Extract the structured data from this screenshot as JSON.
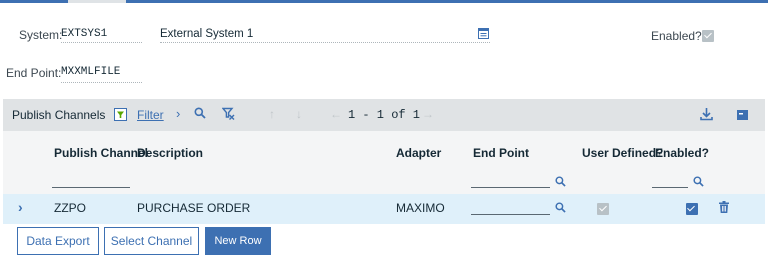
{
  "header": {
    "system_label": "System:",
    "system_value": "EXTSYS1",
    "system_description": "External System 1",
    "enabled_label": "Enabled?",
    "enabled_checked": true,
    "endpoint_label": "End Point:",
    "endpoint_value": "MXXMLFILE"
  },
  "table": {
    "title": "Publish Channels",
    "filter_label": "Filter",
    "pagination": "1 - 1 of 1",
    "columns": {
      "publish_channel": "Publish Channel",
      "description": "Description",
      "adapter": "Adapter",
      "end_point": "End Point",
      "user_defined": "User Defined?",
      "enabled": "Enabled?"
    },
    "rows": [
      {
        "publish_channel": "ZZPO",
        "description": "PURCHASE ORDER",
        "adapter": "MAXIMO",
        "end_point": "",
        "user_defined": true,
        "enabled": true
      }
    ]
  },
  "buttons": {
    "data_export": "Data Export",
    "select_channel": "Select Channel",
    "new_row": "New Row"
  },
  "colors": {
    "accent": "#3d70b2",
    "toolbar_bg": "#e0e3e5",
    "selected_row_bg": "#dff0fa"
  }
}
